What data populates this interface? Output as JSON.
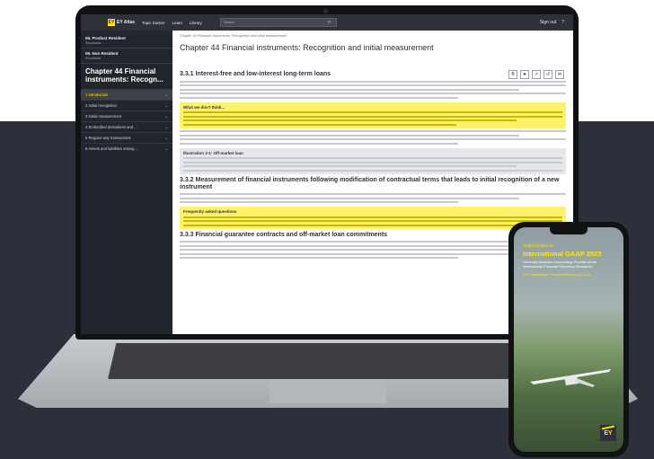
{
  "app": {
    "brand": "EY Atlas",
    "nav": [
      "Topic tracker",
      "Learn",
      "Library"
    ],
    "search_placeholder": "Search",
    "right_items": [
      "Sign out",
      "?"
    ]
  },
  "sidebar": {
    "top_blocks": [
      {
        "head": "06. Product Resident",
        "sub": "Standards ..."
      },
      {
        "head": "09. Non Resident",
        "sub": "Standards ..."
      }
    ],
    "chapter_title": "Chapter 44 Financial instruments: Recogn...",
    "items": [
      "1 Introduction",
      "2 Initial recognition",
      "3 Initial measurement",
      "4 Embedded derivatives and ...",
      "5 Regular way transactions",
      "6 Assets and liabilities arising ..."
    ]
  },
  "content": {
    "breadcrumb": "Chapter 44 Financial instruments: Recognition and initial measurement",
    "chapter_title": "Chapter 44 Financial instruments: Recognition and initial measurement",
    "tools": [
      "B",
      "★",
      "↗",
      "↺",
      "✉"
    ],
    "sections": [
      "3.3.1 Interest-free and low-interest long-term loans",
      "3.3.2 Measurement of financial instruments following modification of contractual terms that leads to initial recognition of a new instrument",
      "3.3.3 Financial guarantee contracts and off-market loan commitments"
    ],
    "highlights": [
      "What we don't think...",
      "Frequently asked questions"
    ],
    "grey_box": "Illustration 3-1: Off-market loan"
  },
  "phone": {
    "kicker": "Global Edition of",
    "title": "International GAAP 2023",
    "subtitle": "Generally Accepted Accounting Practice under International Financial Reporting Standards",
    "note": "EY International Financial Reporting Group",
    "logo": "EY"
  },
  "colors": {
    "accent": "#ffe600",
    "dark": "#2e3138",
    "background": "#2d2f3a"
  }
}
